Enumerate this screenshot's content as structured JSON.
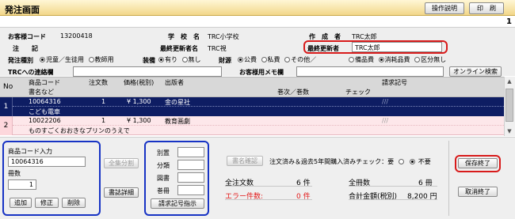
{
  "header": {
    "title": "発注画面",
    "btn_help": "操作説明",
    "btn_print": "印　刷",
    "page_number": "1"
  },
  "info": {
    "customer_code_label": "お客様コード",
    "customer_code": "13200418",
    "school_label": "学　校　名",
    "school_value": "TRC小学校",
    "author_label": "作　成　者",
    "author_value": "TRC太郎",
    "note_label": "注　　記",
    "last_updater_name_label": "最終更新者名",
    "last_updater_name_value": "TRC視",
    "last_updater_label": "最終更新者",
    "last_updater_value": "TRC太郎",
    "order_type_label": "発注種別",
    "order_type_options": [
      "児童／生徒用",
      "教師用"
    ],
    "decoration_label": "装備",
    "decoration_options": [
      "有り",
      "無し"
    ],
    "funding_label": "財源",
    "funding_options": [
      "公費",
      "私費",
      "その他／"
    ],
    "category_options": [
      "備品費",
      "消耗品費",
      "区分無し"
    ],
    "trc_contact_label": "TRCへの連絡欄",
    "memo_label": "お客様用メモ欄",
    "btn_online_search": "オンライン検索"
  },
  "table": {
    "headers": {
      "no": "No",
      "product_code": "商品コード",
      "book_title": "書名など",
      "order_qty": "注文数",
      "price": "価格(税別)",
      "publisher": "出版者",
      "volume": "巻次／巻数",
      "check": "チェック",
      "request_no": "請求記号"
    },
    "rows": [
      {
        "no": "1",
        "code": "10064316",
        "title": "こども電車",
        "qty": "1",
        "price": "¥ 1,300",
        "publisher": "金の星社",
        "request_no": "///"
      },
      {
        "no": "2",
        "code": "10022206",
        "title": "ものすごくおおきなプリンのうえで",
        "qty": "1",
        "price": "¥ 1,300",
        "publisher": "教育画劇",
        "request_no": "///"
      }
    ]
  },
  "bottom": {
    "code_input_label": "商品コード入力",
    "code_input_value": "10064316",
    "qty_label": "冊数",
    "qty_value": "1",
    "btn_add": "追加",
    "btn_modify": "修正",
    "btn_delete": "削除",
    "btn_all_split": "全集分割",
    "btn_book_detail": "書誌詳細",
    "call_labels": [
      "別置",
      "分類",
      "図書",
      "巻冊"
    ],
    "btn_call_number": "請求記号指示",
    "btn_book_confirm": "書名確認",
    "check_label": "注文済み＆過去5年間購入済みチェック：要",
    "check_not_needed": "不要",
    "total_orders_label": "全注文数",
    "total_orders_value": "6 件",
    "total_books_label": "全冊数",
    "total_books_value": "6 冊",
    "error_label": "エラー件数:",
    "error_value": "0 件",
    "total_amount_label": "合計金額(税別)",
    "total_amount_value": "8,200 円",
    "btn_save_exit": "保存終了",
    "btn_cancel_exit": "取消終了"
  }
}
